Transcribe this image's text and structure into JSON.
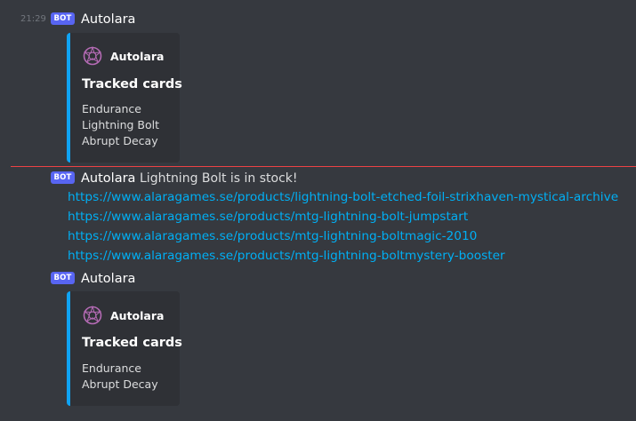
{
  "messages": [
    {
      "timestamp": "21:29",
      "bot_tag": "BOT",
      "username": "Autolara",
      "embed": {
        "author": "Autolara",
        "title": "Tracked cards",
        "lines": [
          "Endurance",
          "Lightning Bolt",
          "Abrupt Decay"
        ]
      }
    },
    {
      "bot_tag": "BOT",
      "username": "Autolara",
      "text": "Lightning Bolt is in stock!",
      "links": [
        "https://www.alaragames.se/products/lightning-bolt-etched-foil-strixhaven-mystical-archive",
        "https://www.alaragames.se/products/mtg-lightning-bolt-jumpstart",
        "https://www.alaragames.se/products/mtg-lightning-boltmagic-2010",
        "https://www.alaragames.se/products/mtg-lightning-boltmystery-booster"
      ]
    },
    {
      "bot_tag": "BOT",
      "username": "Autolara",
      "embed": {
        "author": "Autolara",
        "title": "Tracked cards",
        "lines": [
          "Endurance",
          "Abrupt Decay"
        ]
      }
    }
  ],
  "colors": {
    "background": "#36393f",
    "embed_background": "#2f3136",
    "embed_accent": "#0fa3f3",
    "bot_tag": "#5865f2",
    "link": "#00aff4",
    "new_messages_divider": "#ed4245",
    "author_icon": "#b56bb5"
  },
  "icons": {
    "embed_author_icon": "mtg-planeswalker-icon"
  }
}
